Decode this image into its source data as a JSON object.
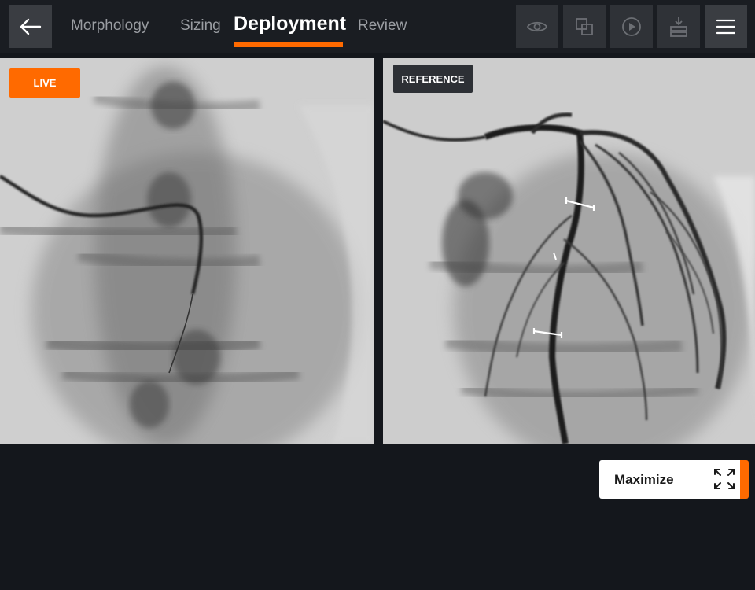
{
  "header": {
    "back_icon": "arrow-left-icon",
    "tabs": [
      {
        "label": "Morphology",
        "active": false
      },
      {
        "label": "Sizing",
        "active": false
      },
      {
        "label": "Deployment",
        "active": true
      },
      {
        "label": "Review",
        "active": false
      }
    ],
    "toolbar": [
      {
        "icon": "eye-icon"
      },
      {
        "icon": "overlay-icon"
      },
      {
        "icon": "play-icon"
      },
      {
        "icon": "download-icon"
      },
      {
        "icon": "menu-icon"
      }
    ]
  },
  "panels": {
    "live": {
      "badge": "LIVE"
    },
    "reference": {
      "badge": "REFERENCE"
    }
  },
  "bottom": {
    "maximize_label": "Maximize",
    "maximize_icon": "expand-icon"
  },
  "colors": {
    "accent": "#ff6a00",
    "background": "#14171c",
    "topbar": "#1a1d22"
  }
}
